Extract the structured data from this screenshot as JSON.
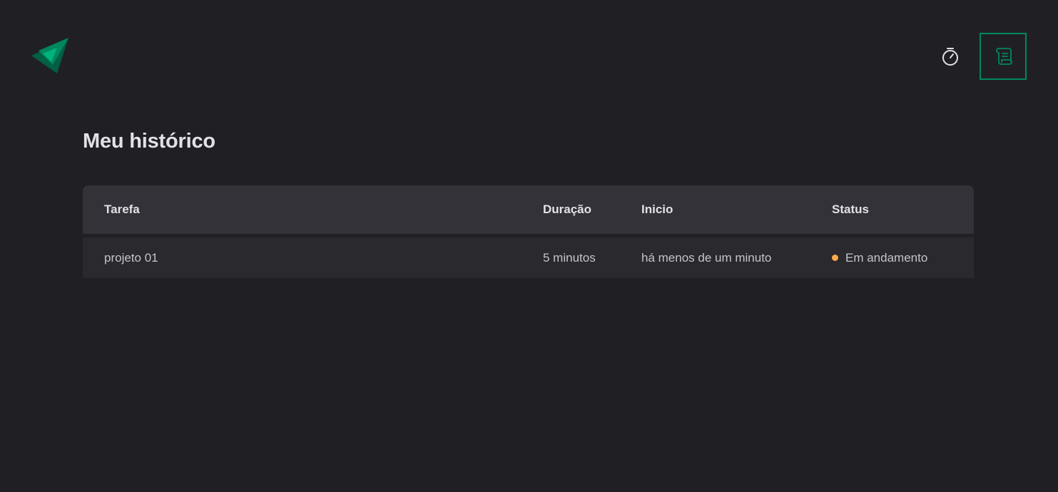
{
  "colors": {
    "background": "#202024",
    "header_row": "#323238",
    "body_row": "#29292e",
    "accent": "#00875f",
    "status_in_progress": "#fba94c"
  },
  "header": {
    "logo": "triangle-logo-icon",
    "nav": [
      {
        "icon": "timer-icon",
        "active": false
      },
      {
        "icon": "scroll-icon",
        "active": true
      }
    ]
  },
  "main": {
    "title": "Meu histórico",
    "table": {
      "columns": [
        "Tarefa",
        "Duração",
        "Inicio",
        "Status"
      ],
      "rows": [
        {
          "task": "projeto 01",
          "duration": "5 minutos",
          "start": "há menos de um minuto",
          "status": "Em andamento",
          "status_color": "#fba94c"
        }
      ]
    }
  }
}
